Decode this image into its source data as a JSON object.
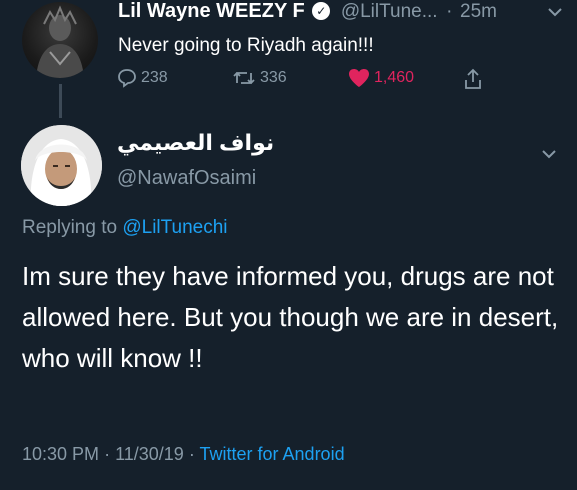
{
  "tweet1": {
    "display_name": "Lil Wayne WEEZY F",
    "handle": "@LilTune...",
    "time": "25m",
    "separator": "·",
    "text": "Never going to Riyadh again!!!",
    "replies": "238",
    "retweets": "336",
    "likes": "1,460"
  },
  "tweet2": {
    "display_name": "نواف العصيمي",
    "handle": "@NawafOsaimi",
    "replying_prefix": "Replying to",
    "replying_to": "@LilTunechi",
    "text": "Im sure they have informed you, drugs are not allowed here. But you though we are in desert, who will know !!",
    "time": "10:30 PM",
    "date": "11/30/19",
    "separator": "·",
    "source": "Twitter for Android"
  },
  "colors": {
    "background": "#15202b",
    "secondary_text": "#8899a6",
    "link": "#1da1f2",
    "like": "#e0245e"
  },
  "icons": [
    "verified-badge-icon",
    "chevron-down-icon",
    "reply-icon",
    "retweet-icon",
    "heart-icon",
    "share-icon"
  ]
}
